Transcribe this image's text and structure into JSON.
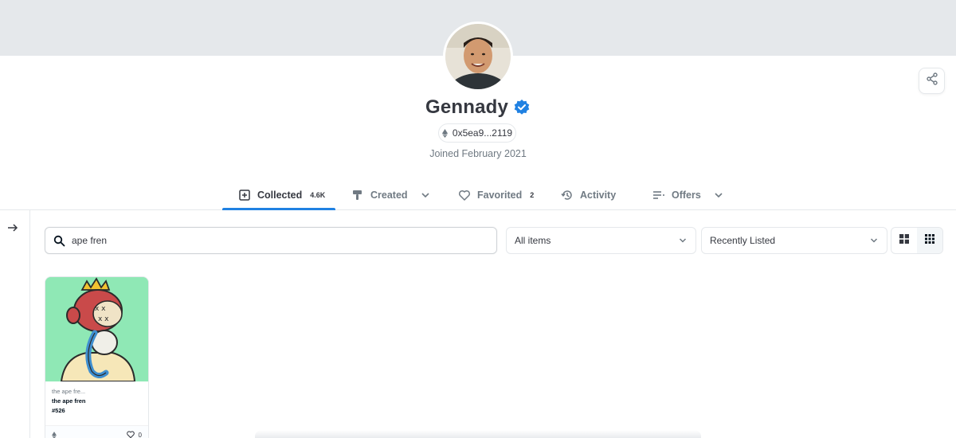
{
  "profile": {
    "name": "Gennady",
    "address": "0x5ea9...2119",
    "joined": "Joined February 2021"
  },
  "tabs": [
    {
      "label": "Collected",
      "count": "4.6K",
      "icon": "collected-icon",
      "active": true
    },
    {
      "label": "Created",
      "icon": "brush-icon",
      "has_dropdown": true
    },
    {
      "label": "Favorited",
      "count": "2",
      "icon": "heart-icon"
    },
    {
      "label": "Activity",
      "icon": "history-icon"
    },
    {
      "label": "Offers",
      "icon": "list-icon",
      "has_dropdown": true
    }
  ],
  "filters": {
    "search_value": "ape fren",
    "items_select": "All items",
    "sort_select": "Recently Listed"
  },
  "cards": [
    {
      "collection": "the ape fre...",
      "title": "the ape fren",
      "token_id": "#526",
      "likes": "0"
    }
  ],
  "colors": {
    "accent": "#2081e2",
    "verified": "#2081e2",
    "card_bg": "#8fe8b5",
    "banner": "#e5e8eb"
  }
}
